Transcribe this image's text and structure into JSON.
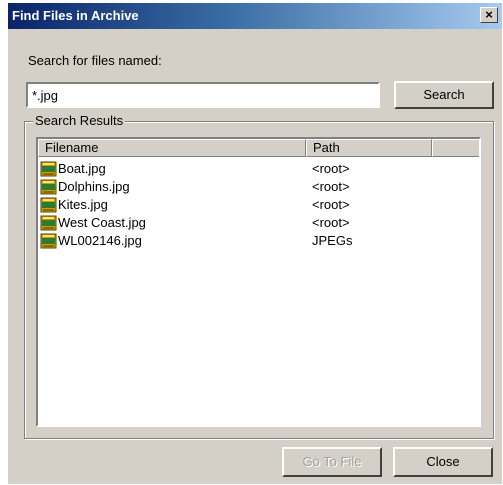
{
  "window": {
    "title": "Find Files in Archive",
    "close_glyph": "×"
  },
  "search": {
    "label": "Search for files named:",
    "value": "*.jpg",
    "button_label": "Search"
  },
  "results": {
    "group_label": "Search Results",
    "columns": [
      "Filename",
      "Path"
    ],
    "rows": [
      {
        "filename": "Boat.jpg",
        "path": "<root>",
        "icon": "jpeg-file-icon"
      },
      {
        "filename": "Dolphins.jpg",
        "path": "<root>",
        "icon": "jpeg-file-icon"
      },
      {
        "filename": "Kites.jpg",
        "path": "<root>",
        "icon": "jpeg-file-icon"
      },
      {
        "filename": "West Coast.jpg",
        "path": "<root>",
        "icon": "jpeg-file-icon"
      },
      {
        "filename": "WL002146.jpg",
        "path": "JPEGs",
        "icon": "jpeg-file-icon"
      }
    ]
  },
  "footer": {
    "goto_label": "Go To File",
    "close_label": "Close"
  }
}
